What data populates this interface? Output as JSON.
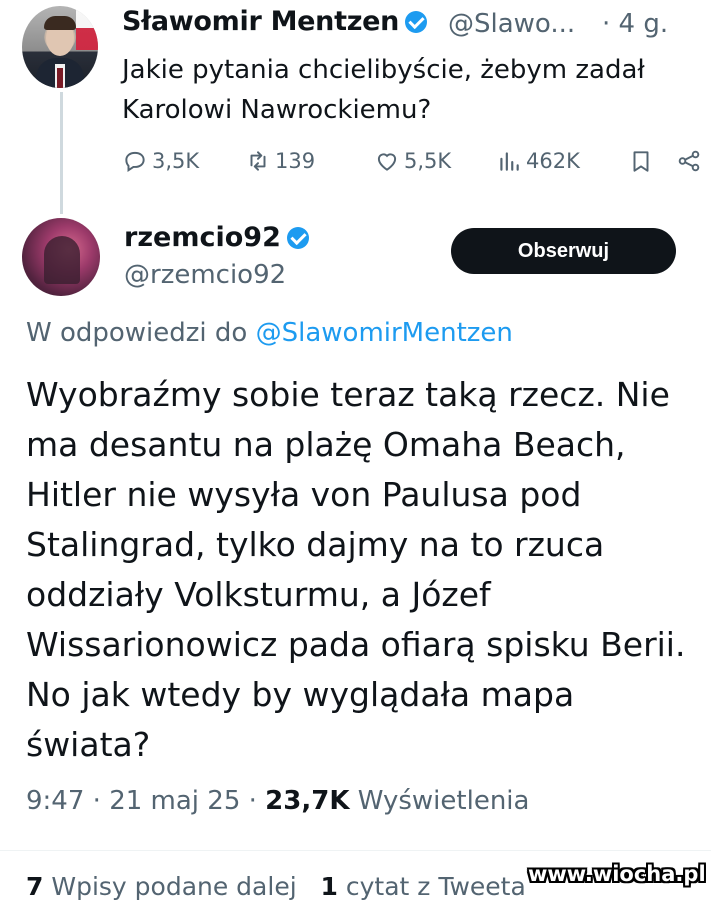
{
  "parent_tweet": {
    "author_name": "Sławomir Mentzen",
    "handle": "@Slawo...",
    "time": "· 4 g.",
    "text": "Jakie pytania chcielibyście, żebym zadał Karolowi Nawrockiemu?",
    "actions": {
      "replies": "3,5K",
      "retweets": "139",
      "likes": "5,5K",
      "views": "462K"
    }
  },
  "reply_tweet": {
    "author_name": "rzemcio92",
    "handle": "@rzemcio92",
    "follow_label": "Obserwuj",
    "reply_to_prefix": "W odpowiedzi do",
    "reply_to_mention": "@SlawomirMentzen",
    "text": "Wyobraźmy sobie teraz taką rzecz. Nie ma desantu na plażę Omaha Beach, Hitler nie wysyła von Paulusa pod Stalingrad, tylko dajmy na to rzuca oddziały Volksturmu, a Józef Wissarionowicz pada ofiarą spisku Berii. No jak wtedy by wyglądała mapa świata?",
    "time": "9:47",
    "date": "21 maj 25",
    "views_count": "23,7K",
    "views_label": "Wyświetlenia",
    "reposts_count": "7",
    "reposts_label": "Wpisy podane dalej",
    "quotes_count": "1",
    "quotes_label": "cytat z Tweeta"
  },
  "watermark": "www.wiocha.pl",
  "colors": {
    "text_primary": "#0f1419",
    "text_secondary": "#536471",
    "accent": "#1d9bf0",
    "button_bg": "#0f1419"
  },
  "icons": [
    "reply-icon",
    "retweet-icon",
    "like-icon",
    "views-icon",
    "bookmark-icon",
    "share-icon",
    "verified-badge-icon"
  ]
}
